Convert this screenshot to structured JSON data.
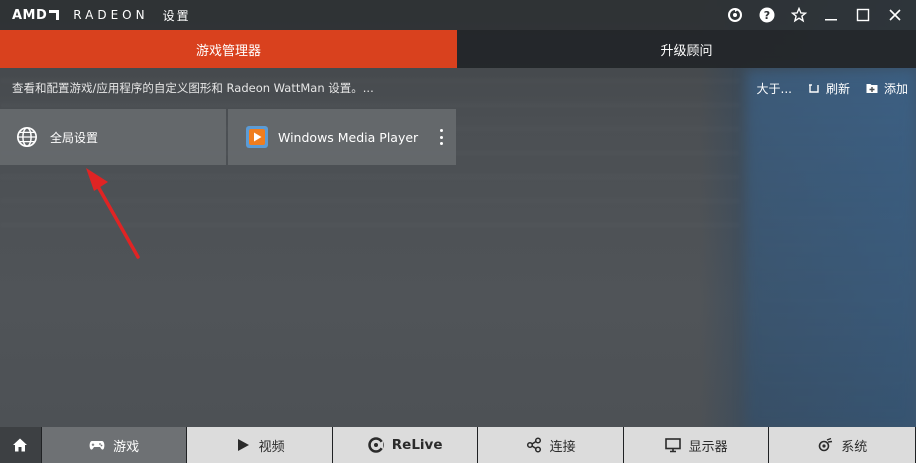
{
  "titlebar": {
    "brand": "AMD",
    "product": "RADEON",
    "settings": "设置"
  },
  "tabs": [
    {
      "label": "游戏管理器",
      "active": true
    },
    {
      "label": "升级顾问",
      "active": false
    }
  ],
  "subheader": {
    "description": "查看和配置游戏/应用程序的自定义图形和 Radeon WattMan 设置。...",
    "size_label": "大于...",
    "refresh_label": "刷新",
    "add_label": "添加"
  },
  "cards": [
    {
      "label": "全局设置",
      "icon": "globe-icon"
    },
    {
      "label": "Windows Media Player",
      "icon": "media-player-icon"
    }
  ],
  "bottomnav": {
    "home_icon": "home-icon",
    "items": [
      {
        "label": "游戏",
        "icon": "gamepad-icon"
      },
      {
        "label": "视频",
        "icon": "play-icon"
      },
      {
        "label": "ReLive",
        "icon": "relive-icon"
      },
      {
        "label": "连接",
        "icon": "share-icon"
      },
      {
        "label": "显示器",
        "icon": "monitor-icon"
      },
      {
        "label": "系统",
        "icon": "system-icon"
      }
    ]
  },
  "colors": {
    "accent": "#d9411e",
    "annotation": "#e02424"
  }
}
